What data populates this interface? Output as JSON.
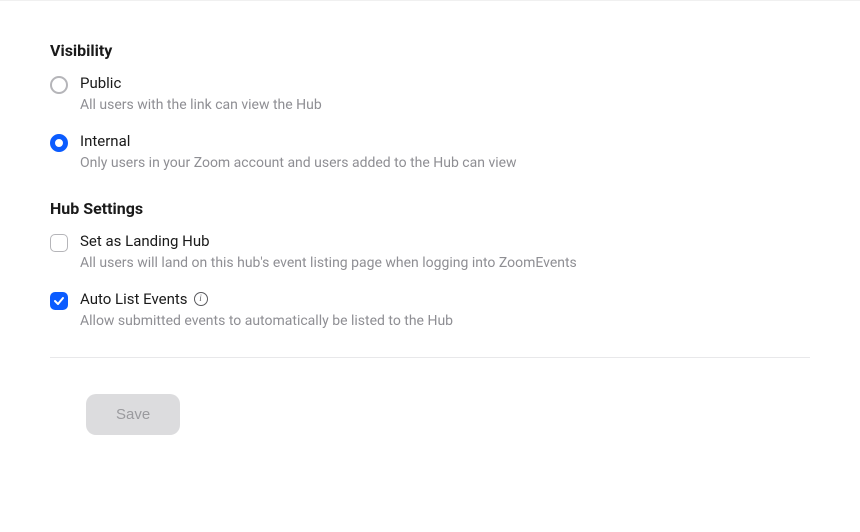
{
  "visibility": {
    "title": "Visibility",
    "options": [
      {
        "label": "Public",
        "description": "All users with the link can view the Hub",
        "selected": false
      },
      {
        "label": "Internal",
        "description": "Only users in your Zoom account and users added to the Hub can view",
        "selected": true
      }
    ]
  },
  "hubSettings": {
    "title": "Hub Settings",
    "options": [
      {
        "label": "Set as Landing Hub",
        "description": "All users will land on this hub's event listing page when logging into ZoomEvents",
        "checked": false,
        "hasInfo": false
      },
      {
        "label": "Auto List Events",
        "description": "Allow submitted events to automatically be listed to the Hub",
        "checked": true,
        "hasInfo": true
      }
    ]
  },
  "footer": {
    "saveLabel": "Save"
  }
}
